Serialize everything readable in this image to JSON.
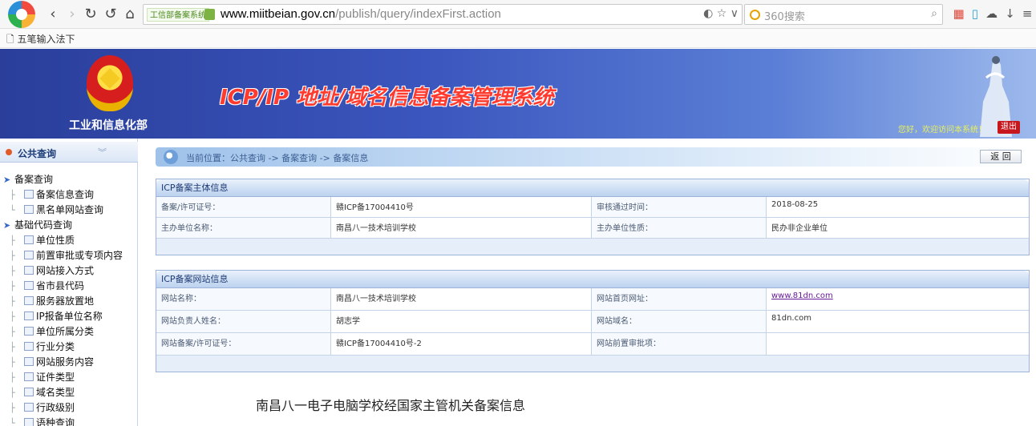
{
  "browser": {
    "address_tag": "工信部备案系统",
    "url_host": "www.miitbeian.gov.cn",
    "url_path": "/publish/query/indexFirst.action",
    "search_placeholder": "360搜索",
    "bookmark": "五笔输入法下"
  },
  "banner": {
    "ministry": "工业和信息化部",
    "title": "ICP/IP 地址/域名信息备案管理系统",
    "welcome": "您好，欢迎访问本系统！",
    "logout": "退出"
  },
  "sidebar": {
    "header": "公共查询",
    "tree": [
      {
        "label": "备案查询",
        "level": 0
      },
      {
        "label": "备案信息查询",
        "level": 1
      },
      {
        "label": "黑名单网站查询",
        "level": 1
      },
      {
        "label": "基础代码查询",
        "level": 0
      },
      {
        "label": "单位性质",
        "level": 1
      },
      {
        "label": "前置审批或专项内容",
        "level": 1
      },
      {
        "label": "网站接入方式",
        "level": 1
      },
      {
        "label": "省市县代码",
        "level": 1
      },
      {
        "label": "服务器放置地",
        "level": 1
      },
      {
        "label": "IP报备单位名称",
        "level": 1
      },
      {
        "label": "单位所属分类",
        "level": 1
      },
      {
        "label": "行业分类",
        "level": 1
      },
      {
        "label": "网站服务内容",
        "level": 1
      },
      {
        "label": "证件类型",
        "level": 1
      },
      {
        "label": "域名类型",
        "level": 1
      },
      {
        "label": "行政级别",
        "level": 1
      },
      {
        "label": "语种查询",
        "level": 1
      }
    ]
  },
  "breadcrumb": {
    "text": "当前位置：公共查询  -> 备案查询  -> 备案信息"
  },
  "back_button": "返 回",
  "subject_panel": {
    "title": "ICP备案主体信息",
    "rows": [
      {
        "k1": "备案/许可证号：",
        "v1": "赣ICP备17004410号",
        "k2": "审核通过时间：",
        "v2": "2018-08-25"
      },
      {
        "k1": "主办单位名称：",
        "v1": "南昌八一技术培训学校",
        "k2": "主办单位性质：",
        "v2": "民办非企业单位"
      }
    ]
  },
  "website_panel": {
    "title": "ICP备案网站信息",
    "rows": [
      {
        "k1": "网站名称：",
        "v1": "南昌八一技术培训学校",
        "k2": "网站首页网址：",
        "v2": "www.81dn.com"
      },
      {
        "k1": "网站负责人姓名：",
        "v1": "胡志学",
        "k2": "网站域名：",
        "v2": "81dn.com"
      },
      {
        "k1": "网站备案/许可证号：",
        "v1": "赣ICP备17004410号-2",
        "k2": "网站前置审批项：",
        "v2": ""
      }
    ]
  },
  "caption": "南昌八一电子电脑学校经国家主管机关备案信息"
}
